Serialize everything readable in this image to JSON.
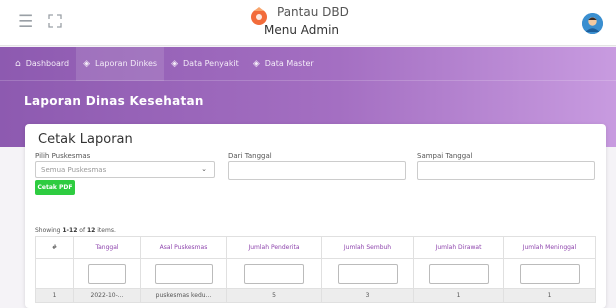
{
  "header": {
    "menu_icon": "hamburger-icon",
    "expand_icon": "fullscreen-icon",
    "brand_name": "Pantau DBD",
    "brand_subtitle": "Menu Admin",
    "brand_logo": "mosquito-logo",
    "avatar": "user-avatar"
  },
  "nav": {
    "items": [
      {
        "label": "Dashboard",
        "icon": "home-icon"
      },
      {
        "label": "Laporan Dinkes",
        "icon": "shield-icon"
      },
      {
        "label": "Data Penyakit",
        "icon": "shield-icon"
      },
      {
        "label": "Data Master",
        "icon": "shield-icon"
      }
    ],
    "active": "Laporan Dinkes"
  },
  "page": {
    "title": "Laporan Dinas Kesehatan"
  },
  "form": {
    "title": "Cetak Laporan",
    "puskesmas_label": "Pilih Puskesmas",
    "puskesmas_value": "Semua Puskesmas",
    "dari_label": "Dari Tanggal",
    "dari_value": "",
    "sampai_label": "Sampai Tanggal",
    "sampai_value": "",
    "pdf_button": "Cetak PDF"
  },
  "summary": {
    "prefix": "Showing ",
    "range": "1-12",
    "middle": " of ",
    "total": "12",
    "suffix": " items."
  },
  "table": {
    "columns": [
      "#",
      "Tanggal",
      "Asal Puskesmas",
      "Jumlah Penderita",
      "Jumlah Sembuh",
      "Jumlah Dirawat",
      "Jumlah Meninggal"
    ],
    "first_row": [
      "1",
      "2022-10-...",
      "puskesmas kedu...",
      "5",
      "3",
      "1",
      "1"
    ]
  },
  "colors": {
    "accent": "#8e44ad",
    "button_green": "#2ecc40",
    "hero_start": "#8d5ab0",
    "hero_end": "#c89be0"
  }
}
